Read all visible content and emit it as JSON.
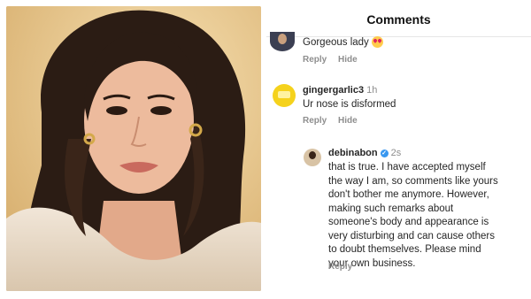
{
  "header": {
    "title": "Comments"
  },
  "comments": [
    {
      "text": "Gorgeous lady",
      "emoji": "heart-eyes-icon",
      "reply_label": "Reply",
      "hide_label": "Hide"
    },
    {
      "username": "gingergarlic3",
      "time": "1h",
      "text": "Ur nose is disformed",
      "reply_label": "Reply",
      "hide_label": "Hide"
    }
  ],
  "reply": {
    "username": "debinabon",
    "time": "2s",
    "verified_icon": "verified-badge-icon",
    "lines": [
      "that is true. I have accepted myself",
      "the way I am, so comments like yours",
      "don't bother me anymore. However,",
      "making such remarks about",
      "someone's body and appearance is",
      "very disturbing and can cause others",
      "to doubt themselves. Please mind",
      "your own business."
    ],
    "reply_label": "Reply"
  },
  "colors": {
    "accent": "#3897f0",
    "muted": "#8e8e8e",
    "text": "#262626"
  }
}
